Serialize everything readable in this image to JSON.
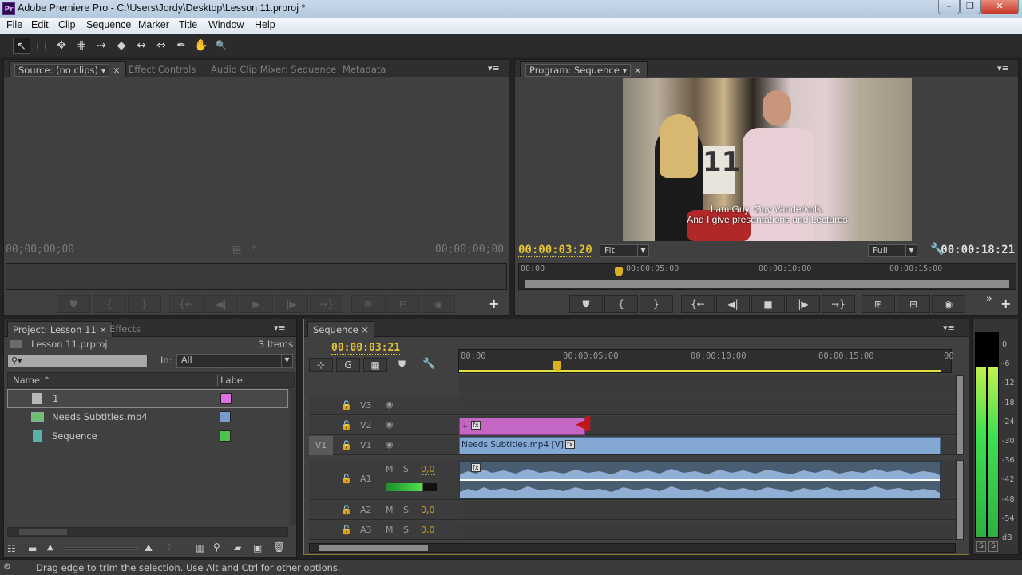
{
  "window": {
    "app_icon": "Pr",
    "title": "Adobe Premiere Pro - C:\\Users\\Jordy\\Desktop\\Lesson 11.prproj *",
    "minimize": "–",
    "restore": "❐",
    "close": "✕"
  },
  "menu": [
    "File",
    "Edit",
    "Clip",
    "Sequence",
    "Marker",
    "Title",
    "Window",
    "Help"
  ],
  "tools": [
    {
      "name": "selection-tool",
      "glyph": "↖"
    },
    {
      "name": "track-select-tool",
      "glyph": "⬚"
    },
    {
      "name": "ripple-edit-tool",
      "glyph": "✥"
    },
    {
      "name": "rolling-edit-tool",
      "glyph": "⋕"
    },
    {
      "name": "rate-stretch-tool",
      "glyph": "⇢"
    },
    {
      "name": "razor-tool",
      "glyph": "◆"
    },
    {
      "name": "slip-tool",
      "glyph": "↔"
    },
    {
      "name": "slide-tool",
      "glyph": "⇔"
    },
    {
      "name": "pen-tool",
      "glyph": "✒"
    },
    {
      "name": "hand-tool",
      "glyph": "✋"
    },
    {
      "name": "zoom-tool",
      "glyph": "🔍"
    }
  ],
  "source_panel": {
    "tabs": [
      "Source: (no clips)",
      "Effect Controls",
      "Audio Clip Mixer: Sequence",
      "Metadata"
    ],
    "timecode_in": "00;00;00;00",
    "timecode_out": "00;00;00;00",
    "buttons": [
      "⛊",
      "{",
      "}",
      "{←",
      "◀|",
      "▶",
      "|▶",
      "→}",
      "⊞",
      "⊟",
      "◉"
    ],
    "add": "+"
  },
  "program_panel": {
    "tab": "Program: Sequence",
    "subtitle_line1": "I am Guy, Guy Vanderkolk.",
    "subtitle_line2": "And I give presentations and Lectures",
    "timecode_current": "00:00:03:20",
    "zoom_select": "Fit",
    "quality_select": "Full",
    "duration": "00:00:18:21",
    "ruler": [
      "00:00",
      "00:00:05:00",
      "00:00:10:00",
      "00:00:15:00"
    ],
    "buttons": [
      "⛊",
      "{",
      "}",
      "{←",
      "◀|",
      "■",
      "|▶",
      "→}",
      "⊞",
      "⊟",
      "◉"
    ],
    "more": "»",
    "add": "+"
  },
  "project_panel": {
    "tabs": [
      "Project: Lesson 11",
      "Effects"
    ],
    "project_file": "Lesson 11.prproj",
    "item_count": "3 Items",
    "search_placeholder": "",
    "in_label": "In:",
    "in_value": "All",
    "columns": [
      "Name",
      "Label"
    ],
    "items": [
      {
        "name": "1",
        "label_color": "#e070e0",
        "icon": "title-icon"
      },
      {
        "name": "Needs Subtitles.mp4",
        "label_color": "#7a9ccc",
        "icon": "video-clip-icon"
      },
      {
        "name": "Sequence",
        "label_color": "#50c050",
        "icon": "sequence-icon"
      }
    ]
  },
  "timeline": {
    "tab": "Sequence",
    "timecode": "00:00:03:21",
    "ruler": [
      "00:00",
      "00:00:05:00",
      "00:00:10:00",
      "00:00:15:00",
      "00"
    ],
    "video_tracks": [
      {
        "name": "V3",
        "source": ""
      },
      {
        "name": "V2",
        "source": ""
      },
      {
        "name": "V1",
        "source": "V1"
      }
    ],
    "audio_tracks": [
      {
        "name": "A1",
        "mute": "M",
        "solo": "S",
        "volume": "0,0"
      },
      {
        "name": "A2",
        "mute": "M",
        "solo": "S",
        "volume": "0,0"
      },
      {
        "name": "A3",
        "mute": "M",
        "solo": "S",
        "volume": "0,0"
      }
    ],
    "clips": {
      "v2_clip": "1",
      "v1_clip": "Needs Subtitles.mp4 [V]",
      "fx": "fx"
    }
  },
  "audio_meter": {
    "scale": [
      "0",
      "-6",
      "-12",
      "-18",
      "-24",
      "-30",
      "-36",
      "-42",
      "-48",
      "-54",
      "dB"
    ],
    "solo": [
      "S",
      "S"
    ]
  },
  "status_bar": {
    "message": "Drag edge to trim the selection. Use Alt and Ctrl for other options."
  }
}
